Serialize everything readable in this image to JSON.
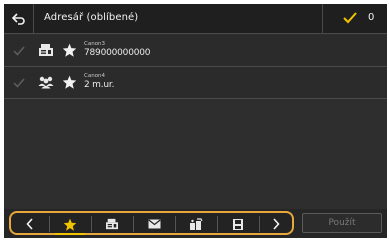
{
  "header": {
    "title": "Adresář (oblíbené)",
    "selected_count": "0"
  },
  "entries": [
    {
      "type_icon": "fax-icon",
      "favorite_icon": "star-icon",
      "name": "Canon3",
      "value": "789000000000"
    },
    {
      "type_icon": "group-icon",
      "favorite_icon": "star-icon",
      "name": "Canon4",
      "value": "2 m.ur."
    }
  ],
  "toolbar": {
    "buttons": [
      "chevron-left-icon",
      "star-icon",
      "fax-icon",
      "email-icon",
      "file-server-icon",
      "memory-media-icon",
      "chevron-right-icon"
    ],
    "active": "star-icon"
  },
  "confirm": {
    "label": "Použít"
  },
  "colors": {
    "accent_check": "#f2c400",
    "toolbar_outline": "#e8a73a",
    "background": "#2e2e2e"
  }
}
